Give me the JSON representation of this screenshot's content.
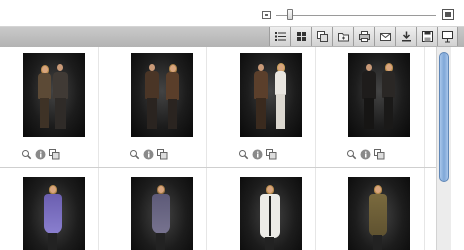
{
  "zoom": {
    "level": 0.17
  },
  "toolbar": {
    "buttons": [
      "list-view-icon",
      "grid-view-icon",
      "copy-icon",
      "new-folder-icon",
      "print-icon",
      "email-icon",
      "download-icon",
      "save-icon",
      "slideshow-icon"
    ]
  },
  "gallery": {
    "row1": [
      "couple-look-1",
      "couple-look-2",
      "couple-look-3",
      "couple-look-4"
    ],
    "row2": [
      "dress-look-purple",
      "dress-look-grey",
      "coat-look-white",
      "coat-look-khaki"
    ],
    "cell_actions": [
      "zoom-icon",
      "info-icon",
      "copy-icon"
    ]
  },
  "colors": {
    "toolbar": "#bdbdbd",
    "thumb_bg": "#1a1a1a",
    "scroll_thumb": "#8fb2de"
  }
}
